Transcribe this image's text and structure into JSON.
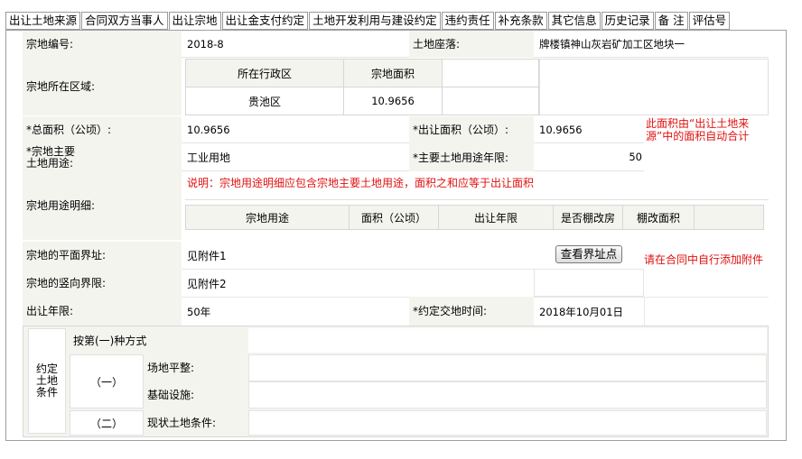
{
  "tabs": [
    "出让土地来源",
    "合同双方当事人",
    "出让宗地",
    "出让金支付约定",
    "土地开发利用与建设约定",
    "违约责任",
    "补充条款",
    "其它信息",
    "历史记录",
    "备 注",
    "评估号"
  ],
  "active_tab": "出让宗地",
  "form": {
    "parcel_no_label": "宗地编号:",
    "parcel_no": "2018-8",
    "location_label": "土地座落:",
    "location": "牌楼镇神山灰岩矿加工区地块一",
    "region_label": "宗地所在区域:",
    "region_table": {
      "headers": [
        "所在行政区",
        "宗地面积"
      ],
      "row": [
        "贵池区",
        "10.9656"
      ]
    },
    "total_area_label": "*总面积（公顷）:",
    "total_area": "10.9656",
    "transfer_area_label": "*出让面积（公顷）:",
    "transfer_area": "10.9656",
    "transfer_area_note": "此面积由“出让土地来源”中的面积自动合计",
    "main_use_label": "*宗地主要\n土地用途:",
    "main_use": "工业用地",
    "use_years_label": "*主要土地用途年限:",
    "use_years": "50",
    "use_detail_label": "宗地用途明细:",
    "use_detail_note": "说明：宗地用途明细应包含宗地主要土地用途，面积之和应等于出让面积",
    "use_detail_headers": [
      "宗地用途",
      "面积（公顷）",
      "出让年限",
      "是否棚改房",
      "棚改面积"
    ],
    "plane_boundary_label": "宗地的平面界址:",
    "plane_boundary": "见附件1",
    "view_points_button": "查看界址点",
    "boundary_note": "请在合同中自行添加附件",
    "vertical_boundary_label": "宗地的竖向界限:",
    "vertical_boundary": "见附件2",
    "term_label": "出让年限:",
    "term": "50年",
    "delivery_time_label": "*约定交地时间:",
    "delivery_time": "2018年10月01日"
  },
  "conditions": {
    "section_label": "约定\n土地\n条件",
    "method": "按第(一)种方式",
    "option1": "（一）",
    "site_leveling_label": "场地平整:",
    "infrastructure_label": "基础设施:",
    "option2": "（二）",
    "current_condition_label": "现状土地条件:"
  },
  "colors": {
    "note_red": "#e01010",
    "label_bg": "#f4f4ef"
  }
}
